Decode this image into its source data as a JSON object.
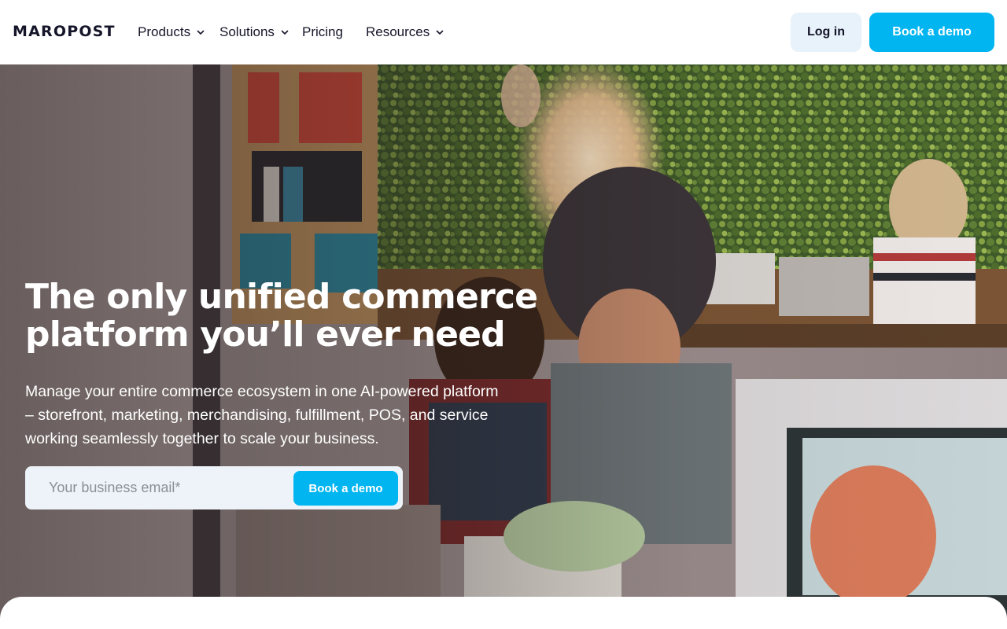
{
  "header": {
    "logo": "MAROPOST",
    "nav": [
      {
        "label": "Products",
        "has_dropdown": true
      },
      {
        "label": "Solutions",
        "has_dropdown": true
      },
      {
        "label": "Pricing",
        "has_dropdown": false
      },
      {
        "label": "Resources",
        "has_dropdown": true
      }
    ],
    "login_label": "Log in",
    "demo_label": "Book a demo"
  },
  "hero": {
    "title": "The only unified commerce platform you’ll ever need",
    "subtitle": "Manage your entire commerce ecosystem in one AI-powered platform – storefront, marketing, merchandising, fulfillment, POS, and service working seamlessly together to scale your business.",
    "email_placeholder": "Your business email*",
    "email_value": "",
    "form_button_label": "Book a demo",
    "background_image": "office-coworkers-photo"
  },
  "colors": {
    "accent": "#00b5f0",
    "login_bg": "#e8f2fb",
    "text_dark": "#15152a"
  },
  "icons": {
    "chevron": "chevron-down-icon"
  }
}
